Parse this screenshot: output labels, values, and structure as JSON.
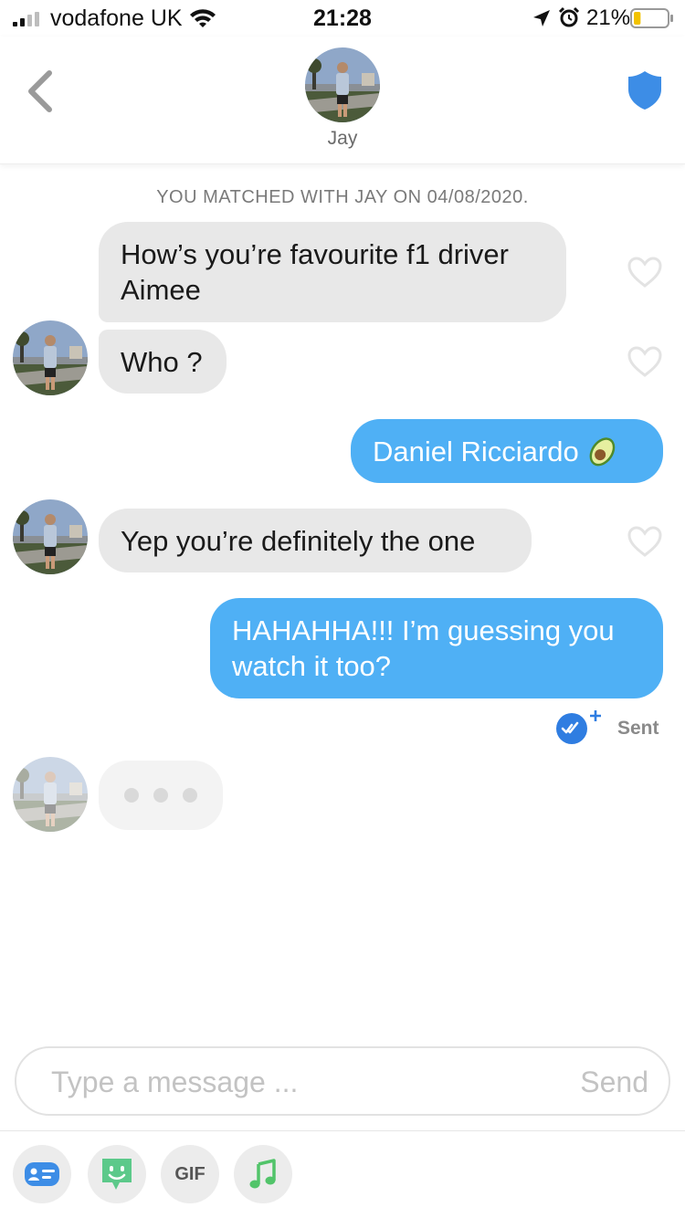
{
  "status_bar": {
    "carrier": "vodafone UK",
    "time": "21:28",
    "battery_percent": "21%",
    "battery_level": 0.21,
    "signal_icon": "cellular-signal-icon",
    "wifi_icon": "wifi-icon",
    "location_icon": "location-arrow-icon",
    "alarm_icon": "alarm-clock-icon",
    "battery_icon": "battery-icon"
  },
  "header": {
    "back_icon": "chevron-left-icon",
    "contact_name": "Jay",
    "safety_icon": "shield-icon"
  },
  "chat": {
    "match_notice": "YOU MATCHED WITH JAY ON 04/08/2020.",
    "messages": [
      {
        "direction": "incoming",
        "text": "How’s you’re favourite f1 driver Aimee"
      },
      {
        "direction": "incoming",
        "text": "Who ?"
      },
      {
        "direction": "outgoing",
        "text": "Daniel Ricciardo",
        "emoji": "avocado-emoji"
      },
      {
        "direction": "incoming",
        "text": "Yep you’re definitely the one"
      },
      {
        "direction": "outgoing",
        "text": "HAHAHHA!!! I’m guessing you watch it too?"
      }
    ],
    "status": "Sent",
    "read_receipt_icon": "double-check-plus-icon",
    "like_icon": "heart-outline-icon",
    "typing_indicator_icon": "typing-dots-icon"
  },
  "composer": {
    "placeholder": "Type a message ...",
    "send_label": "Send"
  },
  "toolbar": {
    "gif_label": "GIF",
    "contact_card_icon": "contact-card-icon",
    "sticker_icon": "sticker-icon",
    "music_icon": "music-note-icon"
  },
  "colors": {
    "outgoing_bubble": "#4fb0f5",
    "incoming_bubble": "#e8e8e8",
    "shield": "#3d8de6",
    "read_receipt": "#2f7de1",
    "music_green": "#52c46a",
    "sticker_green": "#5cc98a",
    "card_blue": "#3d8de6"
  }
}
